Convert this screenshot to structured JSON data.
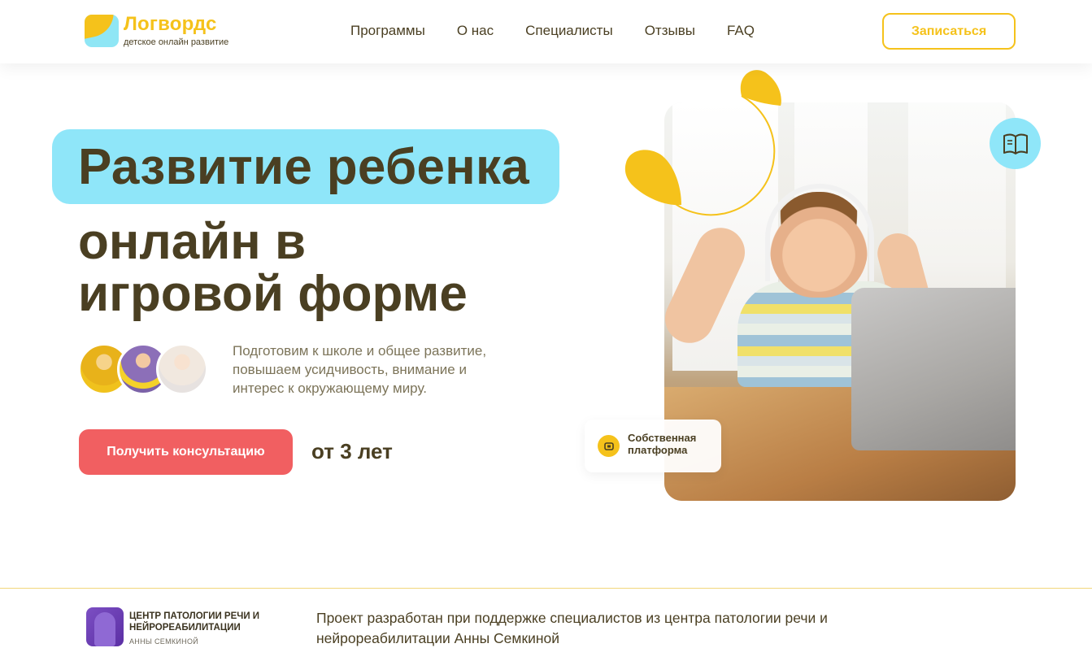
{
  "header": {
    "logo_title": "Логвордс",
    "logo_subtitle": "детское онлайн развитие",
    "nav": [
      "Программы",
      "О нас",
      "Специалисты",
      "Отзывы",
      "FAQ"
    ],
    "signup_label": "Записаться"
  },
  "hero": {
    "title_line1": "Развитие ребенка",
    "title_line2": "онлайн в",
    "title_line3": "игровой форме",
    "description": "Подготовим к школе и общее развитие, повышаем усидчивость, внимание и интерес к окружающему миру.",
    "consult_label": "Получить консультацию",
    "age_label": "от 3 лет"
  },
  "photo_card": {
    "platform_badge": "Собственная платформа",
    "book_icon": "book-open-icon",
    "platform_icon": "platform-icon"
  },
  "partner": {
    "name": "Центр патологии речи и нейрореабилитации",
    "sub": "Анны Семкиной",
    "description": "Проект разработан при поддержке специалистов из центра патологии речи и нейрореабилитации Анны Семкиной"
  },
  "colors": {
    "brand_yellow": "#f5c21b",
    "brand_cyan": "#8fe6f9",
    "accent_red": "#f15f61",
    "text_dark": "#4a3f22"
  }
}
